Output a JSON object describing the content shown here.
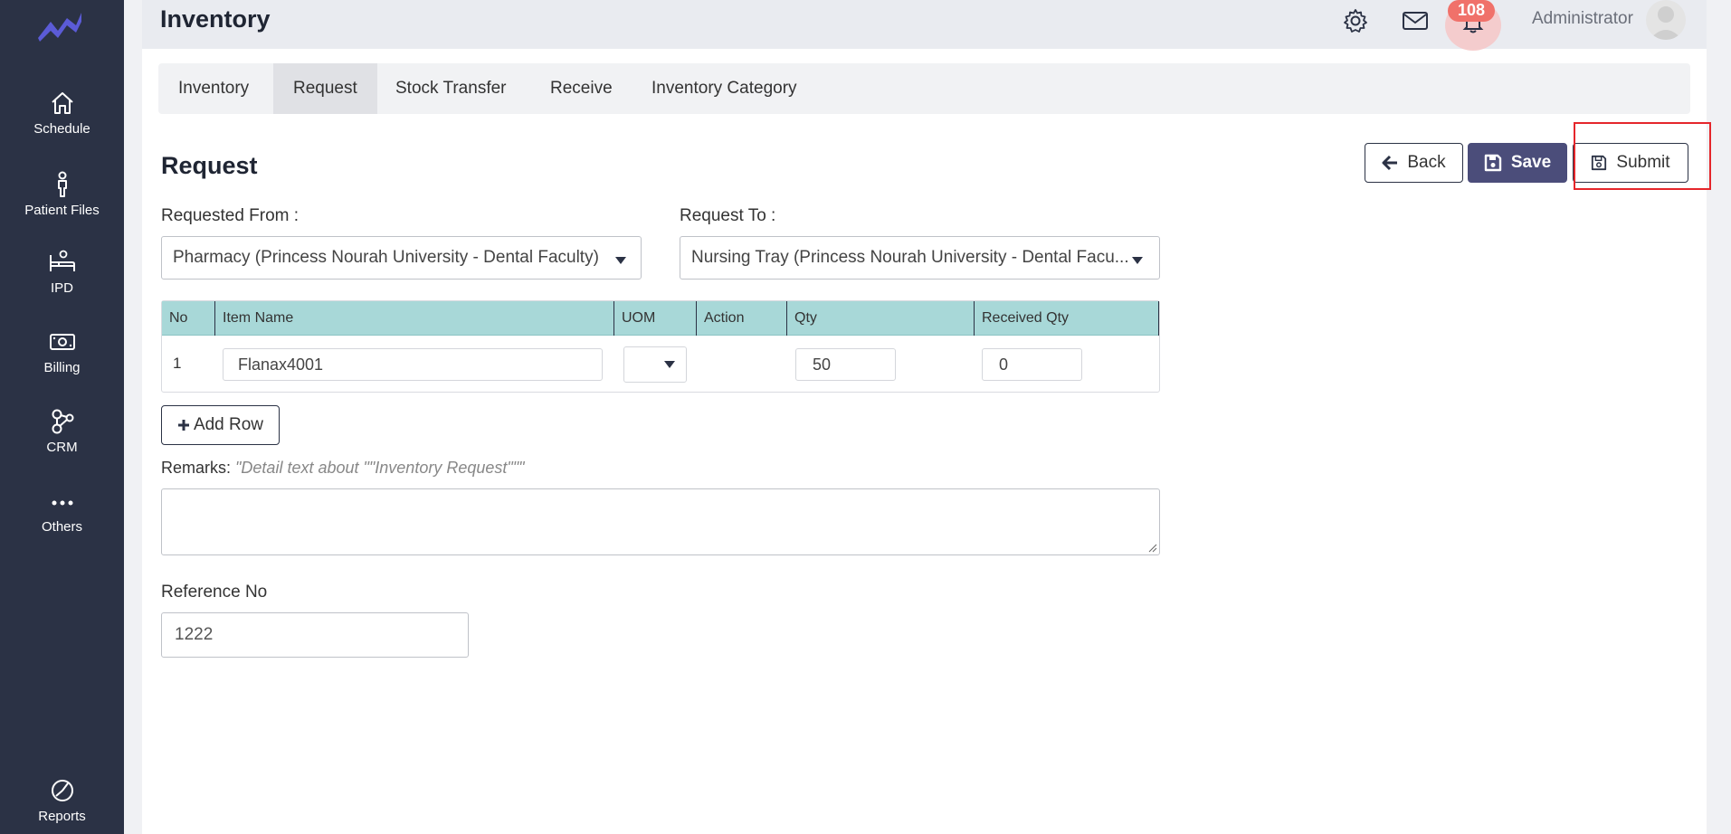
{
  "sidebar": {
    "items": [
      {
        "label": "Schedule",
        "icon": "home-icon"
      },
      {
        "label": "Patient Files",
        "icon": "person-icon"
      },
      {
        "label": "IPD",
        "icon": "bed-icon"
      },
      {
        "label": "Billing",
        "icon": "money-icon"
      },
      {
        "label": "CRM",
        "icon": "network-icon"
      },
      {
        "label": "Others",
        "icon": "more-icon"
      },
      {
        "label": "Reports",
        "icon": "chart-pie-icon"
      }
    ]
  },
  "header": {
    "title": "Inventory",
    "notification_count": "108",
    "user_name": "Administrator"
  },
  "tabs": [
    {
      "label": "Inventory",
      "active": false
    },
    {
      "label": "Request",
      "active": true
    },
    {
      "label": "Stock Transfer",
      "active": false
    },
    {
      "label": "Receive",
      "active": false
    },
    {
      "label": "Inventory Category",
      "active": false
    }
  ],
  "form": {
    "title": "Request",
    "buttons": {
      "back": "Back",
      "save": "Save",
      "submit": "Submit"
    },
    "requested_from_label": "Requested From :",
    "requested_from_value": "Pharmacy (Princess Nourah University - Dental Faculty)",
    "request_to_label": "Request To :",
    "request_to_value": "Nursing Tray (Princess Nourah University - Dental Facu...",
    "table": {
      "headers": [
        "No",
        "Item Name",
        "UOM",
        "Action",
        "Qty",
        "Received Qty"
      ],
      "rows": [
        {
          "no": "1",
          "item_name": "Flanax4001",
          "uom": "",
          "qty": "50",
          "received_qty": "0"
        }
      ]
    },
    "add_row_label": "Add Row",
    "remarks_label": "Remarks:",
    "remarks_hint": "\"Detail text about \"\"Inventory Request\"\"\"",
    "remarks_value": "",
    "reference_label": "Reference No",
    "reference_value": "1222"
  },
  "colors": {
    "sidebar_bg": "#2b3245",
    "primary_button": "#4b4d7a",
    "table_header": "#a8d8d8",
    "badge": "#f0716a",
    "highlight": "#e5262b"
  }
}
